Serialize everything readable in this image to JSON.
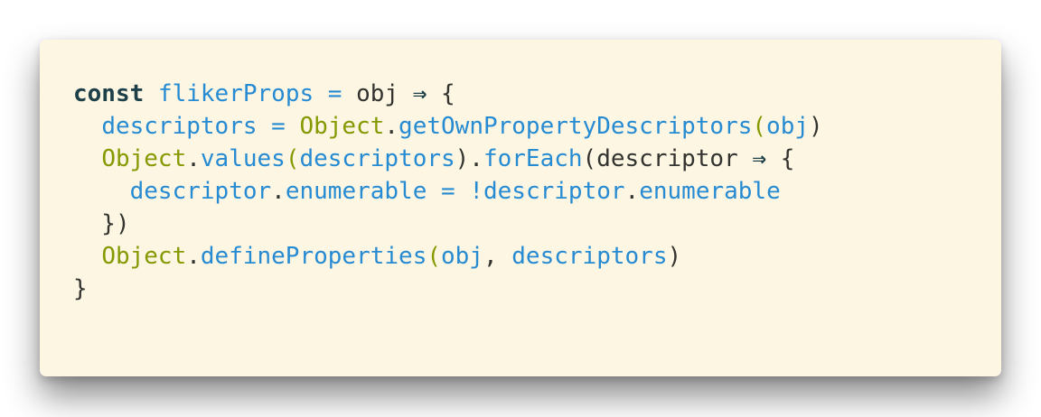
{
  "code_lines": [
    [
      {
        "t": "const",
        "c": "kw"
      },
      {
        "t": " ",
        "c": "pl"
      },
      {
        "t": "flikerProps",
        "c": "var"
      },
      {
        "t": " ",
        "c": "pl"
      },
      {
        "t": "=",
        "c": "op"
      },
      {
        "t": " obj ",
        "c": "pl"
      },
      {
        "t": "⇒",
        "c": "arrow"
      },
      {
        "t": " {",
        "c": "pl"
      }
    ],
    [
      {
        "t": "  ",
        "c": "pl"
      },
      {
        "t": "descriptors",
        "c": "var"
      },
      {
        "t": " ",
        "c": "pl"
      },
      {
        "t": "=",
        "c": "op"
      },
      {
        "t": " ",
        "c": "pl"
      },
      {
        "t": "Object",
        "c": "cls"
      },
      {
        "t": ".",
        "c": "pl"
      },
      {
        "t": "getOwnPropertyDescriptors",
        "c": "var"
      },
      {
        "t": "(",
        "c": "cls"
      },
      {
        "t": "obj",
        "c": "var"
      },
      {
        "t": ")",
        "c": "pl"
      }
    ],
    [
      {
        "t": "  ",
        "c": "pl"
      },
      {
        "t": "Object",
        "c": "cls"
      },
      {
        "t": ".",
        "c": "pl"
      },
      {
        "t": "values",
        "c": "var"
      },
      {
        "t": "(",
        "c": "cls"
      },
      {
        "t": "descriptors",
        "c": "var"
      },
      {
        "t": ").",
        "c": "pl"
      },
      {
        "t": "forEach",
        "c": "var"
      },
      {
        "t": "(descriptor ",
        "c": "pl"
      },
      {
        "t": "⇒",
        "c": "arrow"
      },
      {
        "t": " {",
        "c": "pl"
      }
    ],
    [
      {
        "t": "    ",
        "c": "pl"
      },
      {
        "t": "descriptor",
        "c": "var"
      },
      {
        "t": ".",
        "c": "pl"
      },
      {
        "t": "enumerable",
        "c": "var"
      },
      {
        "t": " ",
        "c": "pl"
      },
      {
        "t": "=",
        "c": "op"
      },
      {
        "t": " ",
        "c": "pl"
      },
      {
        "t": "!",
        "c": "op"
      },
      {
        "t": "descriptor",
        "c": "var"
      },
      {
        "t": ".",
        "c": "pl"
      },
      {
        "t": "enumerable",
        "c": "var"
      }
    ],
    [
      {
        "t": "  })",
        "c": "pl"
      }
    ],
    [
      {
        "t": "  ",
        "c": "pl"
      },
      {
        "t": "Object",
        "c": "cls"
      },
      {
        "t": ".",
        "c": "pl"
      },
      {
        "t": "defineProperties",
        "c": "var"
      },
      {
        "t": "(",
        "c": "cls"
      },
      {
        "t": "obj",
        "c": "var"
      },
      {
        "t": ", ",
        "c": "pl"
      },
      {
        "t": "descriptors",
        "c": "var"
      },
      {
        "t": ")",
        "c": "pl"
      }
    ],
    [
      {
        "t": "}",
        "c": "pl"
      }
    ]
  ]
}
